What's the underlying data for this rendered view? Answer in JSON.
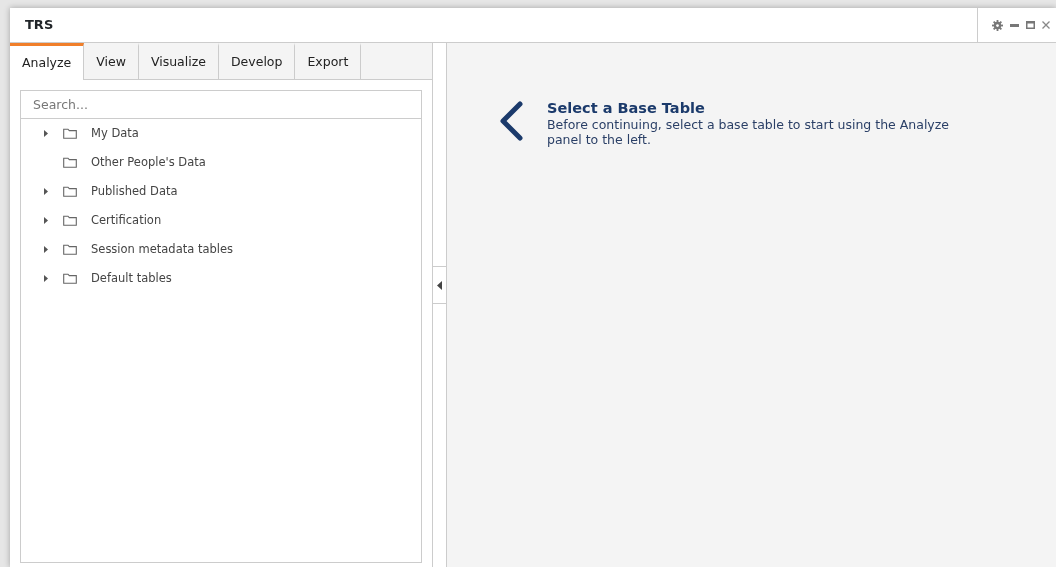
{
  "window": {
    "title": "TRS"
  },
  "tabs": [
    {
      "label": "Analyze",
      "selected": true
    },
    {
      "label": "View",
      "selected": false
    },
    {
      "label": "Visualize",
      "selected": false
    },
    {
      "label": "Develop",
      "selected": false
    },
    {
      "label": "Export",
      "selected": false
    }
  ],
  "search": {
    "placeholder": "Search..."
  },
  "tree": [
    {
      "label": "My Data",
      "expandable": true
    },
    {
      "label": "Other People's Data",
      "expandable": false
    },
    {
      "label": "Published Data",
      "expandable": true
    },
    {
      "label": "Certification",
      "expandable": true
    },
    {
      "label": "Session metadata tables",
      "expandable": true
    },
    {
      "label": "Default tables",
      "expandable": true
    }
  ],
  "message": {
    "title": "Select a Base Table",
    "body": "Before continuing, select a base table to start using the Analyze panel to the left."
  }
}
